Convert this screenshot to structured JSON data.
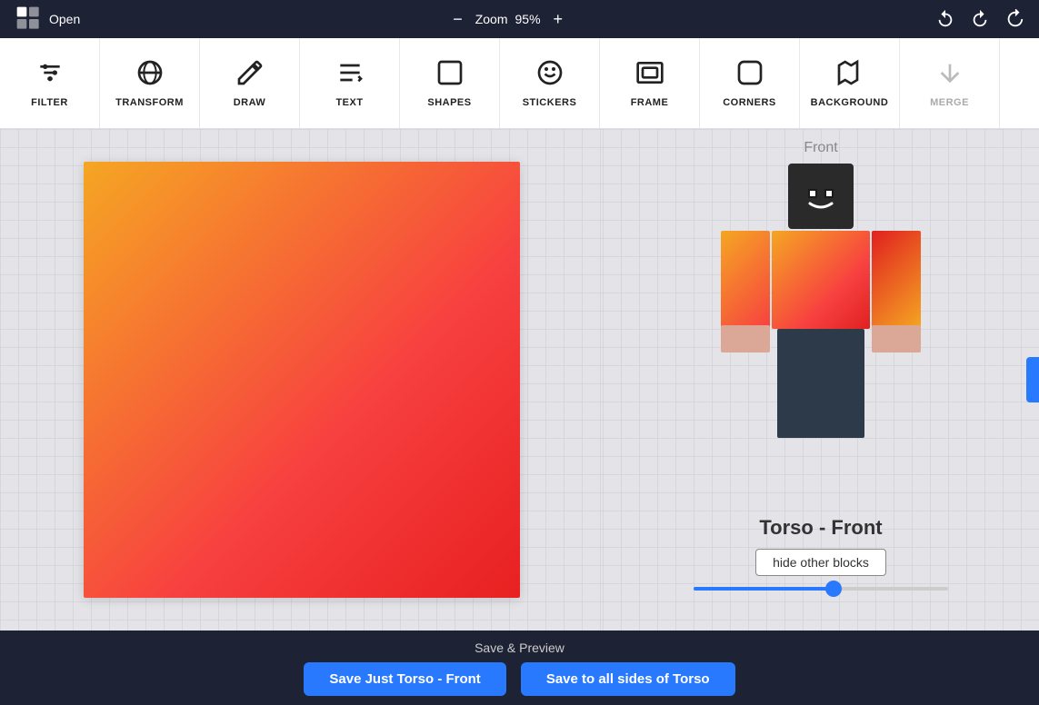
{
  "topbar": {
    "open_label": "Open",
    "zoom_label": "Zoom",
    "zoom_value": "95%",
    "zoom_minus": "−",
    "zoom_plus": "+"
  },
  "toolbar": {
    "filter_label": "FILTER",
    "transform_label": "TRANSFORM",
    "draw_label": "DRAW",
    "text_label": "TEXT",
    "shapes_label": "SHAPES",
    "stickers_label": "STICKERS",
    "frame_label": "FRAME",
    "corners_label": "CORNERS",
    "background_label": "BACKGROUND",
    "merge_label": "MERGE"
  },
  "preview": {
    "front_label": "Front",
    "torso_label": "Torso - Front",
    "hide_blocks_label": "hide other blocks"
  },
  "bottom": {
    "save_preview_label": "Save & Preview",
    "save_just_torso_front": "Save Just Torso - Front",
    "save_all_sides": "Save to all sides of Torso"
  }
}
